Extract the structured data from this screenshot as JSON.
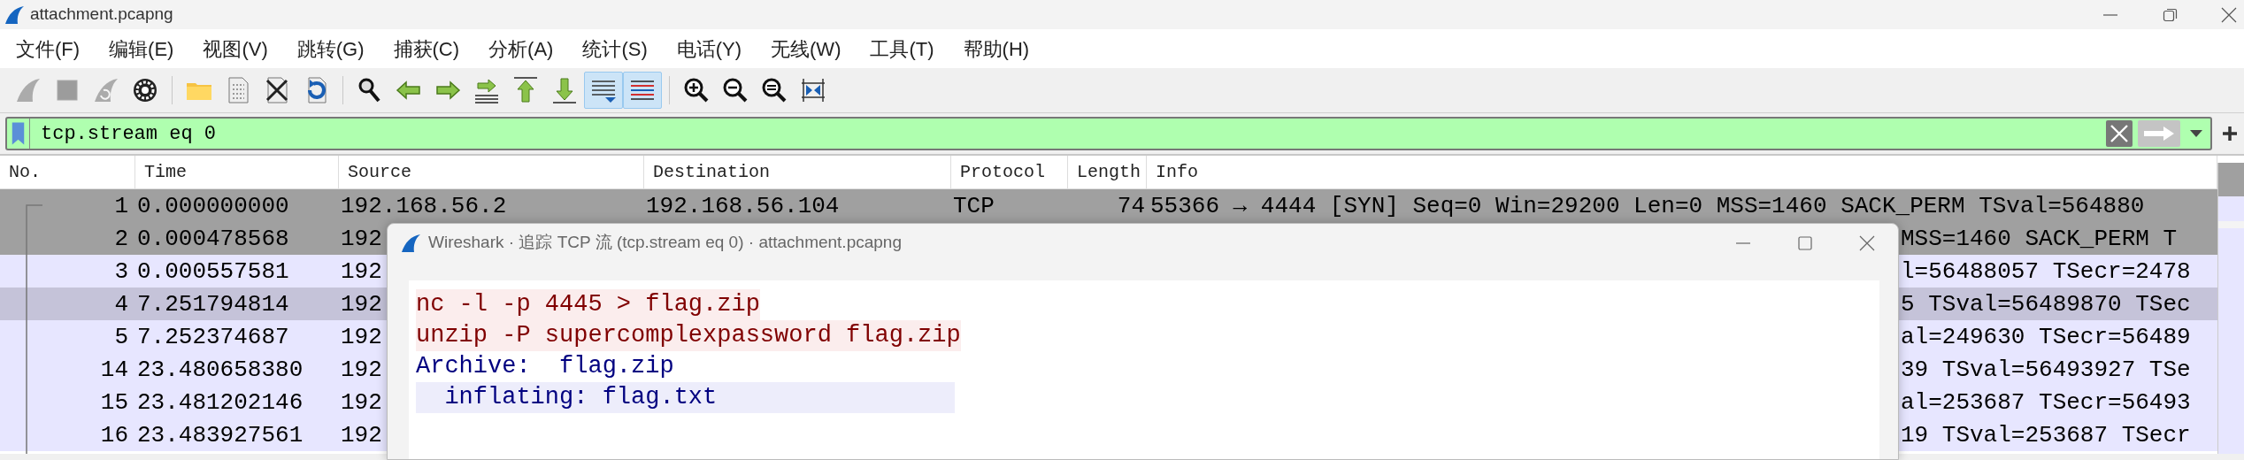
{
  "window": {
    "title": "attachment.pcapng"
  },
  "menu": [
    "文件(F)",
    "编辑(E)",
    "视图(V)",
    "跳转(G)",
    "捕获(C)",
    "分析(A)",
    "统计(S)",
    "电话(Y)",
    "无线(W)",
    "工具(T)",
    "帮助(H)"
  ],
  "toolbar_groups": [
    {
      "buttons": [
        {
          "disabled": true,
          "on": false
        },
        {
          "disabled": true,
          "on": false
        },
        {
          "disabled": true,
          "on": false
        },
        {
          "disabled": false,
          "on": false
        }
      ]
    },
    {
      "buttons": [
        {
          "disabled": false,
          "on": false
        },
        {
          "disabled": false,
          "on": false
        },
        {
          "disabled": false,
          "on": false
        },
        {
          "disabled": false,
          "on": false
        }
      ]
    },
    {
      "buttons": [
        {
          "disabled": false,
          "on": false
        },
        {
          "disabled": false,
          "on": false
        },
        {
          "disabled": false,
          "on": false
        },
        {
          "disabled": false,
          "on": false
        },
        {
          "disabled": false,
          "on": false
        },
        {
          "disabled": false,
          "on": false
        },
        {
          "disabled": false,
          "on": true
        },
        {
          "disabled": false,
          "on": true
        }
      ]
    },
    {
      "buttons": [
        {
          "disabled": false,
          "on": false
        },
        {
          "disabled": false,
          "on": false
        },
        {
          "disabled": false,
          "on": false
        },
        {
          "disabled": false,
          "on": false
        }
      ]
    }
  ],
  "filter": {
    "value": "tcp.stream eq 0"
  },
  "packet_list": {
    "columns": [
      "No.",
      "Time",
      "Source",
      "Destination",
      "Protocol",
      "Length",
      "Info"
    ],
    "rows": [
      {
        "no": "1",
        "time": "0.000000000",
        "source": "192.168.56.2",
        "destination": "192.168.56.104",
        "protocol": "TCP",
        "length": "74",
        "info": "55366 → 4444 [SYN] Seq=0 Win=29200 Len=0 MSS=1460 SACK_PERM TSval=564880",
        "color": "#a0a0a0"
      },
      {
        "no": "2",
        "time": "0.000478568",
        "source": "192",
        "info": "MSS=1460 SACK_PERM T",
        "color": "#a0a0a0"
      },
      {
        "no": "3",
        "time": "0.000557581",
        "source": "192",
        "info": "l=56488057 TSecr=2478",
        "color": "#e7e6ff"
      },
      {
        "no": "4",
        "time": "7.251794814",
        "source": "192",
        "info": "5 TSval=56489870 TSec",
        "color": "#c5c3d9"
      },
      {
        "no": "5",
        "time": "7.252374687",
        "source": "192",
        "info": "al=249630 TSecr=56489",
        "color": "#e7e6ff"
      },
      {
        "no": "14",
        "time": "23.480658380",
        "source": "192",
        "info": "39 TSval=56493927 TSe",
        "color": "#e7e6ff"
      },
      {
        "no": "15",
        "time": "23.481202146",
        "source": "192",
        "info": "al=253687 TSecr=56493",
        "color": "#e7e6ff"
      },
      {
        "no": "16",
        "time": "23.483927561",
        "source": "192",
        "info": "19 TSval=253687 TSecr",
        "color": "#e7e6ff"
      }
    ]
  },
  "follow_dialog": {
    "title": "Wireshark · 追踪 TCP 流 (tcp.stream eq 0) · attachment.pcapng",
    "lines": [
      {
        "kind": "client",
        "text": "nc -l -p 4445 > flag.zip",
        "highlighted": true
      },
      {
        "kind": "client",
        "text": "unzip -P supercomplexpassword flag.zip",
        "highlighted": true
      },
      {
        "kind": "server",
        "text": "Archive:  flag.zip",
        "highlighted": false
      },
      {
        "kind": "server",
        "text": "  inflating: flag.txt",
        "highlighted": true
      }
    ]
  }
}
